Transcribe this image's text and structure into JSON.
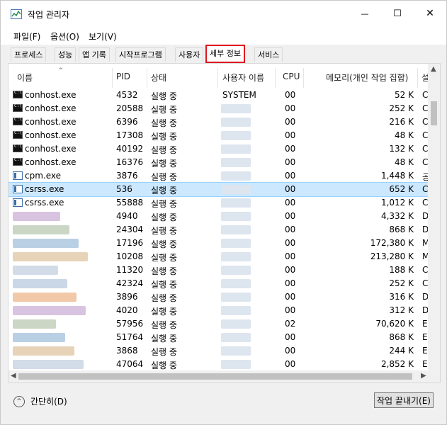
{
  "window": {
    "title": "작업 관리자",
    "minimize_glyph": "—",
    "maximize_glyph": "☐",
    "close_glyph": "✕",
    "app_icon": "task-manager-icon"
  },
  "menu": {
    "items": [
      "파일(F)",
      "옵션(O)",
      "보기(V)"
    ]
  },
  "tabs": [
    "프로세스",
    "성능",
    "앱 기록",
    "시작프로그램",
    "사용자",
    "세부 정보",
    "서비스"
  ],
  "active_tab": "세부 정보",
  "accent_colors": {
    "highlight_border": "#e0161f",
    "selected_row": "#cce8ff"
  },
  "columns": [
    "이름",
    "PID",
    "상태",
    "사용자 이름",
    "CPU",
    "메모리(개인 작업 집합)",
    "설"
  ],
  "rows": [
    {
      "name": "conhost.exe",
      "pid": "4532",
      "status": "실행 중",
      "user": "SYSTEM",
      "cpu": "00",
      "memory": "52 K",
      "desc": "C",
      "icon": "console-icon"
    },
    {
      "name": "conhost.exe",
      "pid": "20588",
      "status": "실행 중",
      "user": "",
      "cpu": "00",
      "memory": "252 K",
      "desc": "C",
      "icon": "console-icon"
    },
    {
      "name": "conhost.exe",
      "pid": "6396",
      "status": "실행 중",
      "user": "",
      "cpu": "00",
      "memory": "216 K",
      "desc": "C",
      "icon": "console-icon"
    },
    {
      "name": "conhost.exe",
      "pid": "17308",
      "status": "실행 중",
      "user": "",
      "cpu": "00",
      "memory": "48 K",
      "desc": "C",
      "icon": "console-icon"
    },
    {
      "name": "conhost.exe",
      "pid": "40192",
      "status": "실행 중",
      "user": "",
      "cpu": "00",
      "memory": "132 K",
      "desc": "C",
      "icon": "console-icon"
    },
    {
      "name": "conhost.exe",
      "pid": "16376",
      "status": "실행 중",
      "user": "",
      "cpu": "00",
      "memory": "48 K",
      "desc": "C",
      "icon": "console-icon"
    },
    {
      "name": "cpm.exe",
      "pid": "3876",
      "status": "실행 중",
      "user": "",
      "cpu": "00",
      "memory": "1,448 K",
      "desc": "공",
      "icon": "app-icon"
    },
    {
      "name": "csrss.exe",
      "pid": "536",
      "status": "실행 중",
      "user": "",
      "cpu": "00",
      "memory": "652 K",
      "desc": "C",
      "icon": "app-icon",
      "selected": true
    },
    {
      "name": "csrss.exe",
      "pid": "55888",
      "status": "실행 중",
      "user": "",
      "cpu": "00",
      "memory": "1,012 K",
      "desc": "C",
      "icon": "app-icon"
    },
    {
      "name": "",
      "pid": "4940",
      "status": "실행 중",
      "user": "",
      "cpu": "00",
      "memory": "4,332 K",
      "desc": "D"
    },
    {
      "name": "",
      "pid": "24304",
      "status": "실행 중",
      "user": "",
      "cpu": "00",
      "memory": "868 K",
      "desc": "D"
    },
    {
      "name": "",
      "pid": "17196",
      "status": "실행 중",
      "user": "",
      "cpu": "00",
      "memory": "172,380 K",
      "desc": "M"
    },
    {
      "name": "",
      "pid": "10208",
      "status": "실행 중",
      "user": "",
      "cpu": "00",
      "memory": "213,280 K",
      "desc": "M"
    },
    {
      "name": "",
      "pid": "11320",
      "status": "실행 중",
      "user": "",
      "cpu": "00",
      "memory": "188 K",
      "desc": "C"
    },
    {
      "name": "",
      "pid": "42324",
      "status": "실행 중",
      "user": "",
      "cpu": "00",
      "memory": "252 K",
      "desc": "C"
    },
    {
      "name": "",
      "pid": "3896",
      "status": "실행 중",
      "user": "",
      "cpu": "00",
      "memory": "316 K",
      "desc": "D"
    },
    {
      "name": "",
      "pid": "4020",
      "status": "실행 중",
      "user": "",
      "cpu": "00",
      "memory": "312 K",
      "desc": "D"
    },
    {
      "name": "",
      "pid": "57956",
      "status": "실행 중",
      "user": "",
      "cpu": "02",
      "memory": "70,620 K",
      "desc": "E"
    },
    {
      "name": "",
      "pid": "51764",
      "status": "실행 중",
      "user": "",
      "cpu": "00",
      "memory": "868 K",
      "desc": "E"
    },
    {
      "name": "",
      "pid": "3868",
      "status": "실행 중",
      "user": "",
      "cpu": "00",
      "memory": "244 K",
      "desc": "E"
    },
    {
      "name": "",
      "pid": "47064",
      "status": "실행 중",
      "user": "",
      "cpu": "00",
      "memory": "2,852 K",
      "desc": "E"
    }
  ],
  "footer": {
    "fewer_details": "간단히(D)",
    "end_task": "작업 끝내기(E)"
  }
}
